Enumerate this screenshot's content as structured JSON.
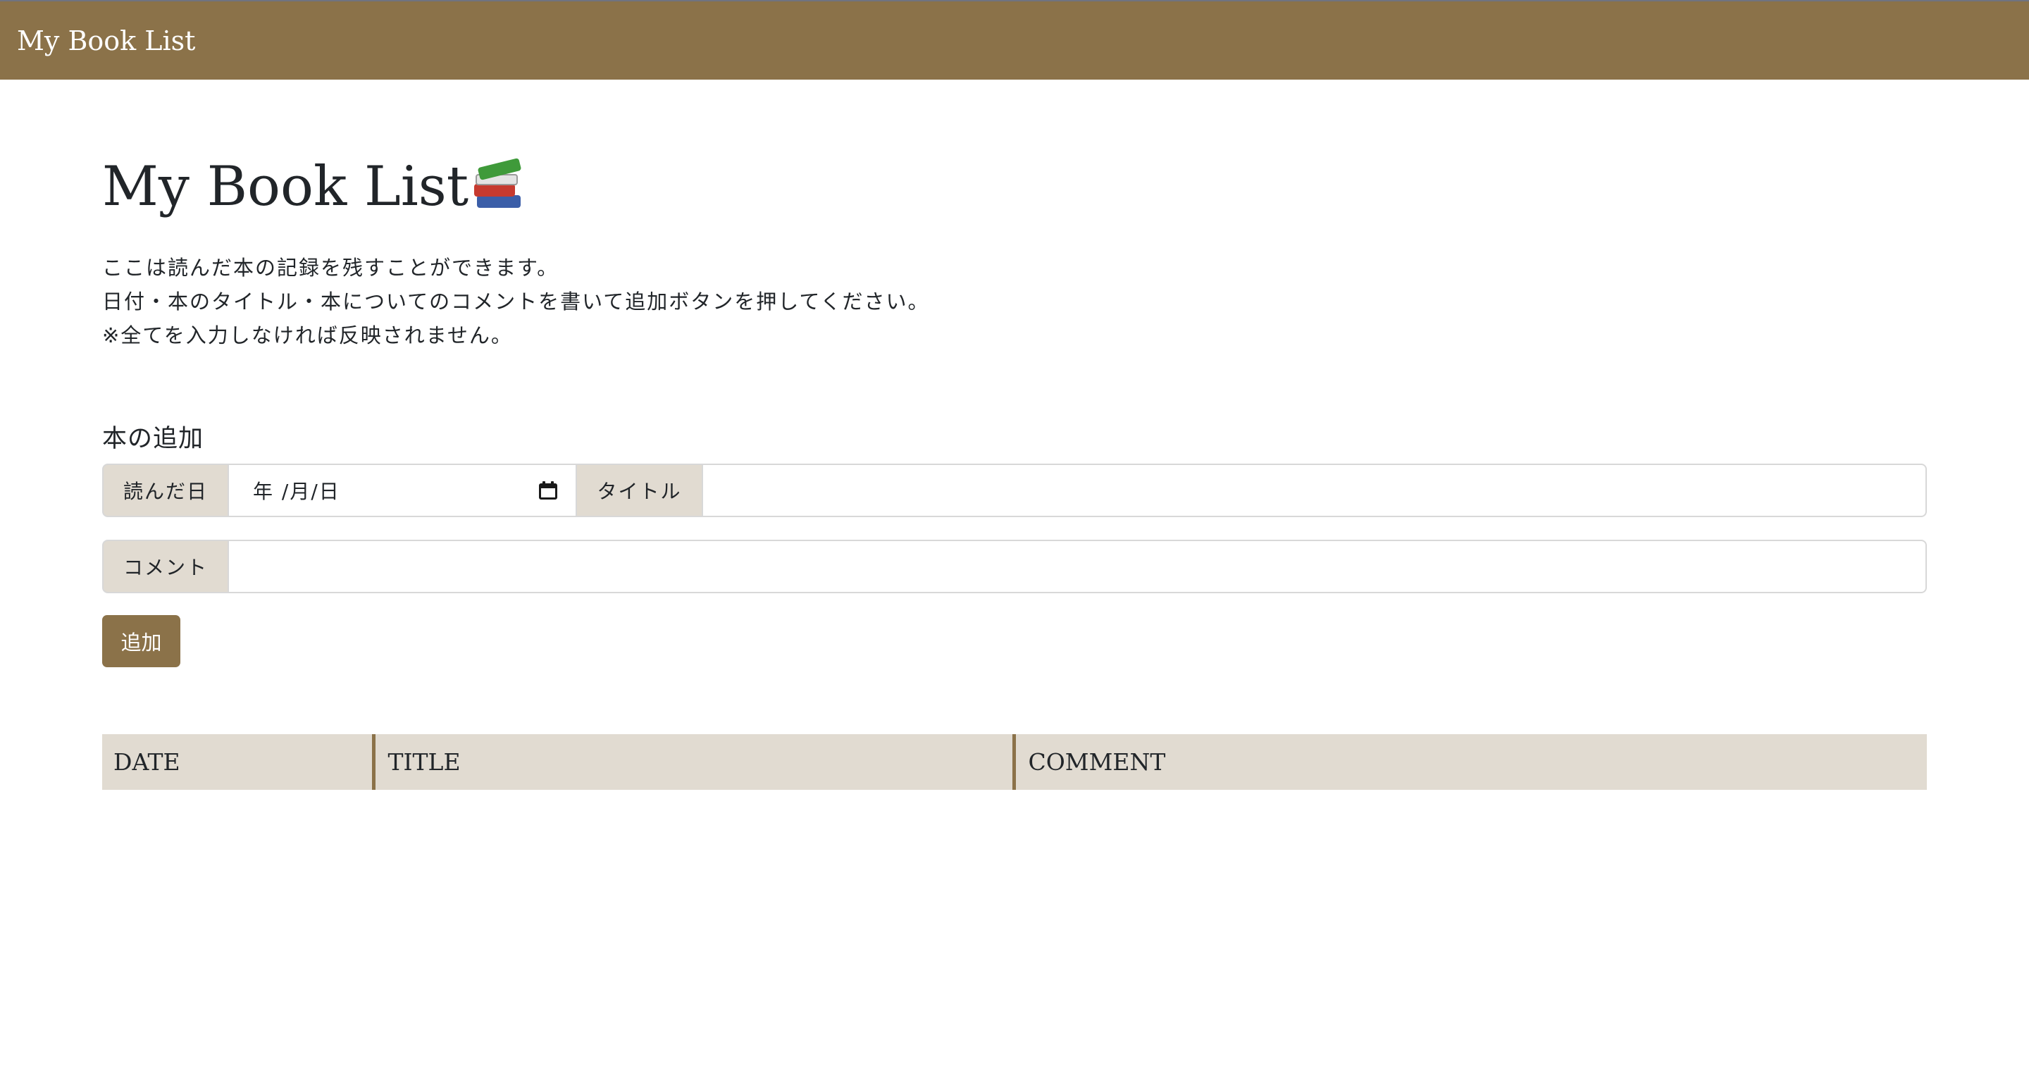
{
  "navbar": {
    "brand": "My Book List"
  },
  "header": {
    "title": "My Book List",
    "title_icon": "books-icon"
  },
  "intro": {
    "lines": [
      "ここは読んだ本の記録を残すことができます。",
      "日付・本のタイトル・本についてのコメントを書いて追加ボタンを押してください。",
      "※全てを入力しなければ反映されません。"
    ]
  },
  "form": {
    "section_title": "本の追加",
    "date_label": "読んだ日",
    "date_placeholder": "年 /月/日",
    "title_label": "タイトル",
    "title_value": "",
    "comment_label": "コメント",
    "comment_value": "",
    "submit_label": "追加"
  },
  "table": {
    "headers": [
      "DATE",
      "TITLE",
      "COMMENT"
    ],
    "rows": []
  },
  "colors": {
    "accent": "#8b7249",
    "addon_bg": "#e1dbd1"
  }
}
